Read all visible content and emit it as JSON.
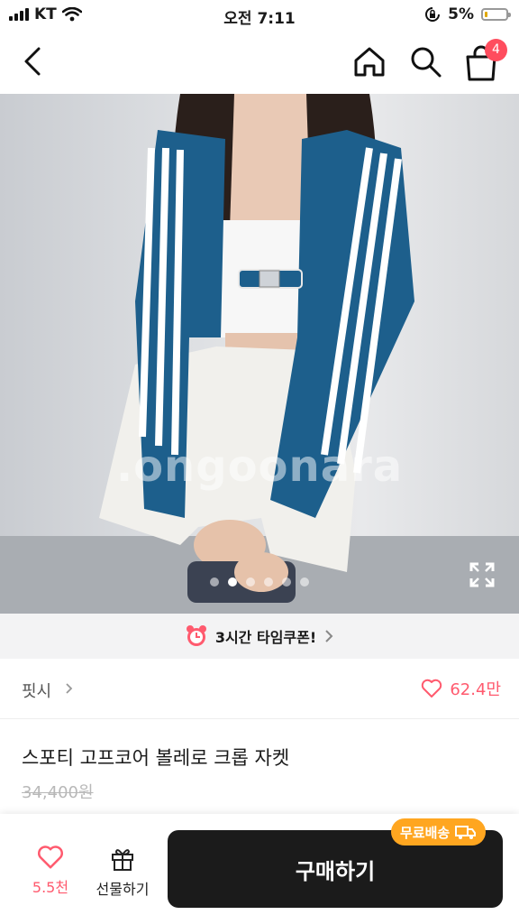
{
  "status_bar": {
    "carrier": "KT",
    "time": "오전 7:11",
    "battery": "5%"
  },
  "nav": {
    "cart_count": "4"
  },
  "hero": {
    "watermark": ".ongoonara",
    "total_images": 6,
    "active_index": 1
  },
  "coupon": {
    "label": "3시간 타임쿠폰!"
  },
  "store": {
    "name": "핏시",
    "likes": "62.4만"
  },
  "product": {
    "title": "스포티 고프코어 볼레로 크롭 자켓",
    "original_price": "34,400원"
  },
  "bottom_bar": {
    "like_count": "5.5천",
    "gift_label": "선물하기",
    "buy_label": "구매하기",
    "free_shipping_label": "무료배송"
  },
  "colors": {
    "accent_pink": "#ff5a6e",
    "badge_red": "#ff4d5e",
    "free_ship_orange": "#ffa620",
    "buy_button": "#1b1b1b"
  },
  "icons": [
    "signal-icon",
    "wifi-icon",
    "lock-rotation-icon",
    "battery-icon",
    "back-icon",
    "home-icon",
    "search-icon",
    "cart-icon",
    "expand-icon",
    "alarm-clock-icon",
    "chevron-right-icon",
    "heart-icon",
    "gift-icon",
    "truck-icon"
  ]
}
